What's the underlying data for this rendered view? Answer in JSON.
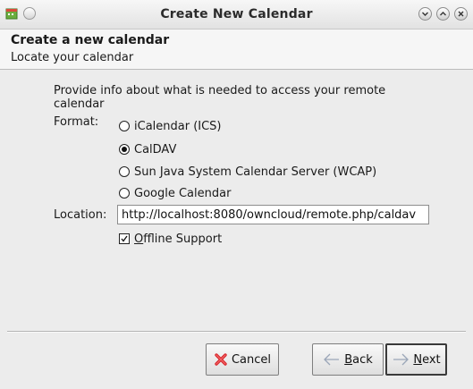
{
  "window": {
    "title": "Create New Calendar",
    "icons": [
      "app-calendar-icon",
      "window-menu-icon",
      "minimize-icon",
      "maximize-icon",
      "close-icon"
    ]
  },
  "header": {
    "title": "Create a new calendar",
    "subtitle": "Locate your calendar"
  },
  "form": {
    "description": "Provide info about what is needed to access your remote calendar",
    "format_label": "Format:",
    "format_options": [
      {
        "label": "iCalendar (ICS)",
        "selected": false
      },
      {
        "label": "CalDAV",
        "selected": true
      },
      {
        "label": "Sun Java System Calendar Server (WCAP)",
        "selected": false
      },
      {
        "label": "Google Calendar",
        "selected": false
      }
    ],
    "location_label": "Location:",
    "location_value": "http://localhost:8080/owncloud/remote.php/caldav",
    "offline_label_prefix": "O",
    "offline_label_rest": "ffline Support",
    "offline_checked": true
  },
  "buttons": {
    "cancel": "Cancel",
    "back_mnemonic": "B",
    "back_rest": "ack",
    "next_mnemonic": "N",
    "next_rest": "ext"
  },
  "colors": {
    "window_bg": "#ececec",
    "header_bg": "#f6f6f6",
    "cancel_icon": "#d9262c",
    "nav_arrow": "#9aa6b8"
  }
}
